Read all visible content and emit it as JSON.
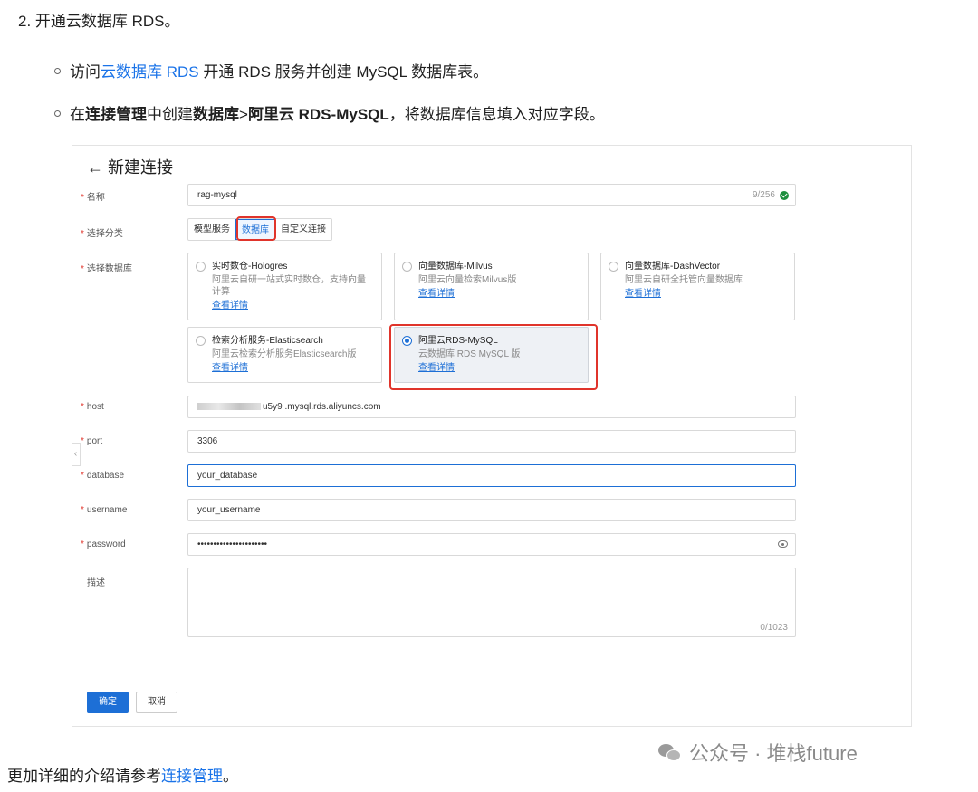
{
  "doc": {
    "step_title": "2. 开通云数据库 RDS。",
    "bullet1": {
      "pre": "访问",
      "link": "云数据库 RDS",
      "post": " 开通 RDS 服务并创建 MySQL 数据库表。"
    },
    "bullet2": {
      "p1": "在",
      "b1": "连接管理",
      "p2": "中创建",
      "b2": "数据库",
      "p3": ">",
      "b3": "阿里云 RDS-MySQL",
      "p4": "，将数据库信息填入对应字段。"
    },
    "footer": {
      "pre": "更加详细的介绍请参考",
      "link": "连接管理",
      "post": "。"
    },
    "watermark": "公众号 · 堆栈future"
  },
  "form": {
    "back_arrow": "←",
    "title": "新建连接",
    "required_mark": "*",
    "labels": {
      "name": "名称",
      "category": "选择分类",
      "database_type": "选择数据库",
      "host": "host",
      "port": "port",
      "database": "database",
      "username": "username",
      "password": "password",
      "description": "描述"
    },
    "name_value": "rag-mysql",
    "name_counter": "9/256",
    "categories": [
      "模型服务",
      "数据库",
      "自定义连接"
    ],
    "selected_category": "数据库",
    "db_cards": [
      {
        "name": "实时数仓-Hologres",
        "desc": "阿里云自研一站式实时数仓，支持向量计算",
        "link": "查看详情",
        "selected": false
      },
      {
        "name": "向量数据库-Milvus",
        "desc": "阿里云向量检索Milvus版",
        "link": "查看详情",
        "selected": false
      },
      {
        "name": "向量数据库-DashVector",
        "desc": "阿里云自研全托管向量数据库",
        "link": "查看详情",
        "selected": false
      },
      {
        "name": "检索分析服务-Elasticsearch",
        "desc": "阿里云检索分析服务Elasticsearch版",
        "link": "查看详情",
        "selected": false
      },
      {
        "name": "阿里云RDS-MySQL",
        "desc": "云数据库 RDS MySQL 版",
        "link": "查看详情",
        "selected": true
      }
    ],
    "host_value": "u5y9  .mysql.rds.aliyuncs.com",
    "port_value": "3306",
    "database_value": "your_database",
    "username_value": "your_username",
    "password_value": "••••••••••••••••••••••",
    "description_counter": "0/1023",
    "collapse_glyph": "‹",
    "confirm_label": "确定",
    "cancel_label": "取消"
  },
  "colors": {
    "link": "#1a73e8",
    "primary": "#1d6fd6",
    "highlight": "#e0342b",
    "required": "#e0342b"
  }
}
